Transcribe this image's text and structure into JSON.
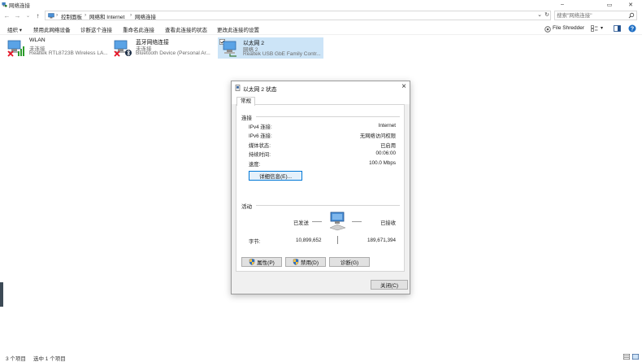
{
  "window": {
    "title": "网络连接",
    "minimize": "–",
    "maximize": "▭",
    "close": "✕"
  },
  "nav": {
    "back": "←",
    "forward": "→",
    "recent": "⌄",
    "up": "↑",
    "breadcrumbs": [
      "控制面板",
      "网络和 Internet",
      "网络连接"
    ],
    "separator": "›",
    "dropdown": "⌄",
    "refresh": "↻"
  },
  "search": {
    "placeholder": "搜索\"网络连接\""
  },
  "toolbar": {
    "organize": "组织 ▾",
    "disable": "禁用此网络设备",
    "diagnose": "诊断这个连接",
    "rename": "重命名此连接",
    "view_status": "查看此连接的状态",
    "change_settings": "更改此连接的设置",
    "file_shredder": "File Shredder",
    "view_dropdown": "▾"
  },
  "connections": [
    {
      "name": "WLAN",
      "status": "未连接",
      "device": "Realtek RTL8723B Wireless LA..."
    },
    {
      "name": "蓝牙网络连接",
      "status": "未连接",
      "device": "Bluetooth Device (Personal Ar..."
    },
    {
      "name": "以太网 2",
      "status": "网络 2",
      "device": "Realtek USB GbE Family Contr..."
    }
  ],
  "dialog": {
    "title": "以太网 2 状态",
    "tab": "常规",
    "connection_group": "连接",
    "rows": [
      {
        "label": "IPv4 连接:",
        "value": "Internet"
      },
      {
        "label": "IPv6 连接:",
        "value": "无网络访问权限"
      },
      {
        "label": "媒体状态:",
        "value": "已启用"
      },
      {
        "label": "持续时间:",
        "value": "00:06:00"
      },
      {
        "label": "速度:",
        "value": "100.0 Mbps"
      }
    ],
    "details_button": "详细信息(E)...",
    "activity_group": "活动",
    "sent_label": "已发送",
    "received_label": "已接收",
    "bytes_label": "字节:",
    "bytes_sent": "10,899,652",
    "bytes_received": "189,671,394",
    "properties_button": "属性(P)",
    "disable_button": "禁用(D)",
    "diagnose_button": "诊断(G)",
    "close_button": "关闭(C)"
  },
  "status": {
    "item_count": "3 个项目",
    "selected": "选中 1 个项目"
  },
  "colors": {
    "selection": "#cce4f7",
    "dialog_bg": "#f0f0f0",
    "focus_border": "#0078d7",
    "error_red": "#e81123"
  }
}
